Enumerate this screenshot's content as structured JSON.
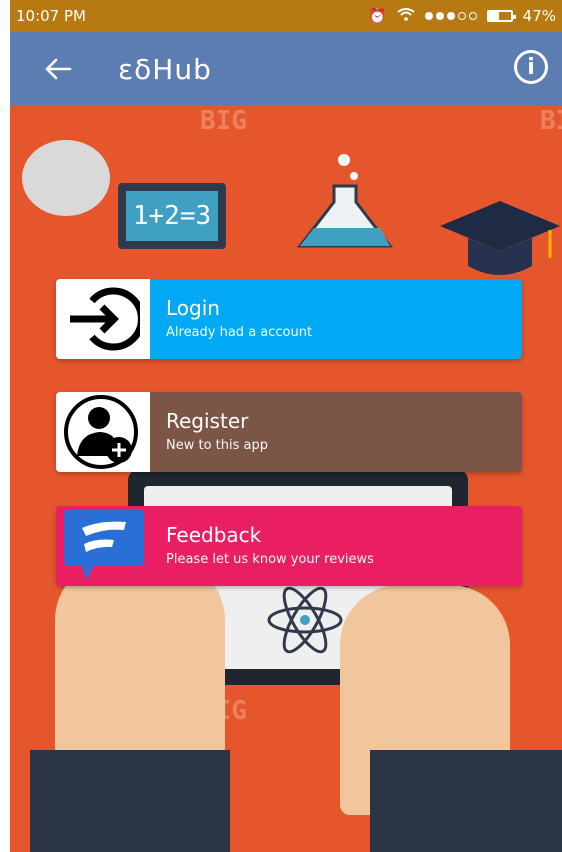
{
  "status_bar": {
    "time": "10:07 PM",
    "battery_text": "47%",
    "battery_level": 0.47
  },
  "app_bar": {
    "title": "εδHub",
    "back_icon": "arrow-left-icon",
    "info_icon": "info-icon"
  },
  "colors": {
    "status": "#b77a12",
    "appbar": "#5b7db1",
    "login": "#03a9f4",
    "register": "#7b5546",
    "feedback": "#e91e63",
    "background": "#e6562c"
  },
  "background": {
    "board_text": "1+2=3",
    "watermarks": [
      "BIG",
      "BIG",
      "BIG"
    ]
  },
  "cards": [
    {
      "title": "Login",
      "subtitle": "Already had a account",
      "icon": "login-arrow-icon"
    },
    {
      "title": "Register",
      "subtitle": "New to this app",
      "icon": "add-user-icon"
    },
    {
      "title": "Feedback",
      "subtitle": "Please let us know your reviews",
      "icon": "feedback-icon"
    }
  ]
}
